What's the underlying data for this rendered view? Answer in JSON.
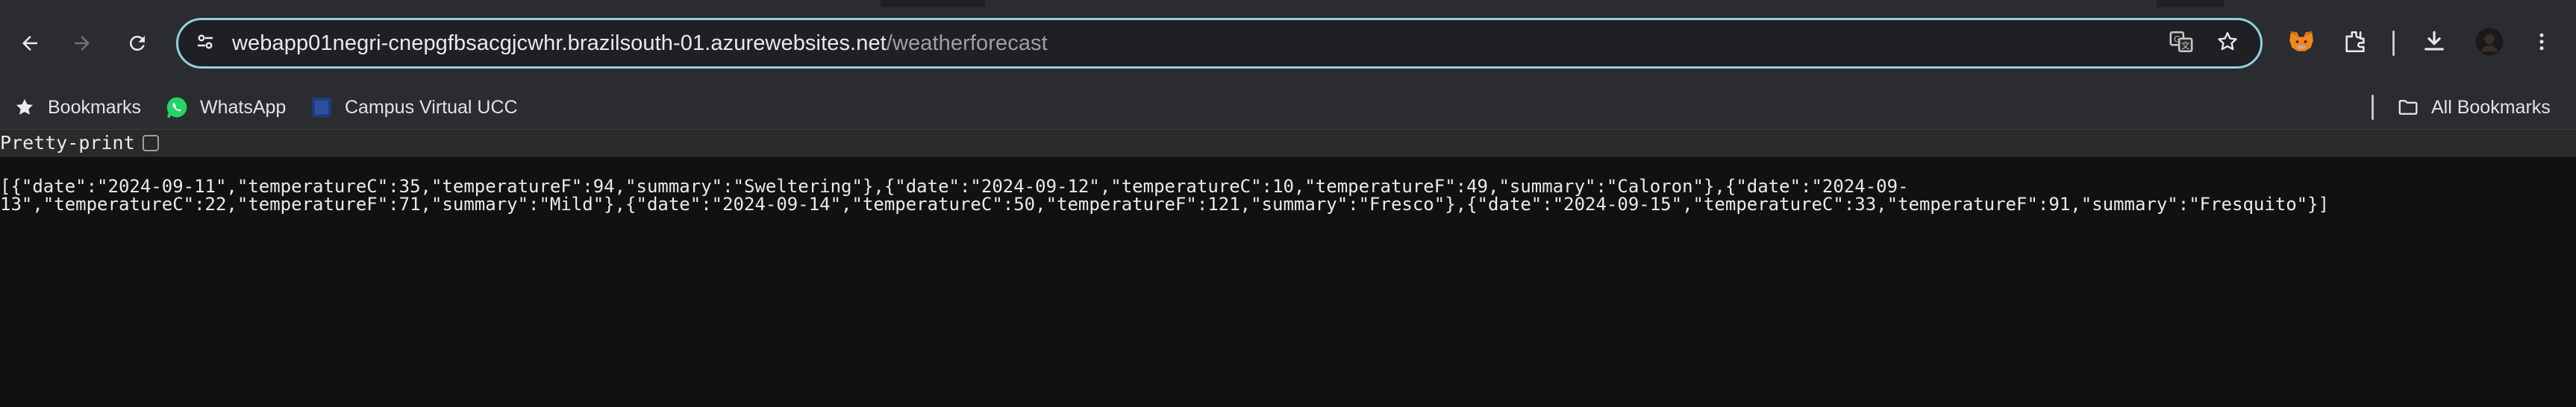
{
  "browser": {
    "url_host": "webapp01negri-cnepgfbsacgjcwhr.brazilsouth-01.azurewebsites.net",
    "url_path": "/weatherforecast",
    "icons": {
      "back": "arrow-left-icon",
      "forward": "arrow-right-icon",
      "reload": "reload-icon",
      "site_info": "tune-icon",
      "translate": "translate-icon",
      "bookmark_star": "star-icon",
      "metamask": "fox-extension-icon",
      "extensions": "puzzle-icon",
      "downloads": "download-icon",
      "profile": "avatar",
      "menu": "kebab-menu-icon"
    },
    "accent_color": "#8fd3df"
  },
  "bookmarks_bar": {
    "items": [
      {
        "label": "Bookmarks",
        "icon": "star-icon"
      },
      {
        "label": "WhatsApp",
        "icon": "whatsapp-icon"
      },
      {
        "label": "Campus Virtual UCC",
        "icon": "site-favicon"
      }
    ],
    "all_bookmarks_label": "All Bookmarks"
  },
  "page": {
    "pretty_print_label": "Pretty-print",
    "pretty_print_checked": false,
    "json_line_1": "[{\"date\":\"2024-09-11\",\"temperatureC\":35,\"temperatureF\":94,\"summary\":\"Sweltering\"},{\"date\":\"2024-09-12\",\"temperatureC\":10,\"temperatureF\":49,\"summary\":\"Caloron\"},{\"date\":\"2024-09-",
    "json_line_2": "13\",\"temperatureC\":22,\"temperatureF\":71,\"summary\":\"Mild\"},{\"date\":\"2024-09-14\",\"temperatureC\":50,\"temperatureF\":121,\"summary\":\"Fresco\"},{\"date\":\"2024-09-15\",\"temperatureC\":33,\"temperatureF\":91,\"summary\":\"Fresquito\"}]"
  }
}
